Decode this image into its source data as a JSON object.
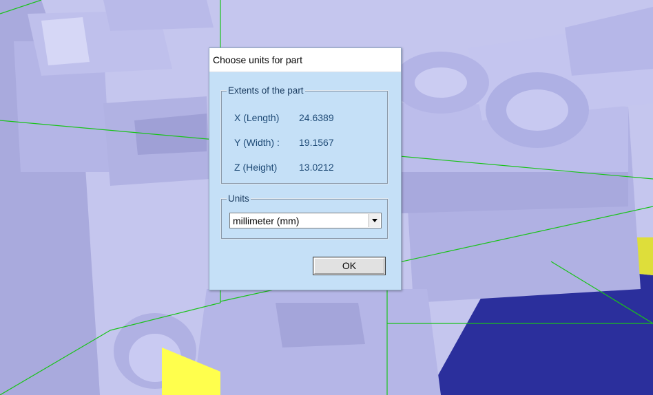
{
  "dialog": {
    "title": "Choose units for part",
    "extents": {
      "legend": "Extents of the part",
      "rows": [
        {
          "label": "X (Length)",
          "value": "24.6389"
        },
        {
          "label": "Y (Width) :",
          "value": "19.1567"
        },
        {
          "label": "Z (Height)",
          "value": "13.0212"
        }
      ]
    },
    "units": {
      "legend": "Units",
      "selected": "millimeter (mm)"
    },
    "ok_label": "OK"
  },
  "scene": {
    "model_name": "3d-part-model",
    "colors": {
      "part": "#c7c8f0",
      "grid": "#19c319",
      "highlight": "#ffff4d",
      "ground": "#2b2f9c"
    }
  }
}
